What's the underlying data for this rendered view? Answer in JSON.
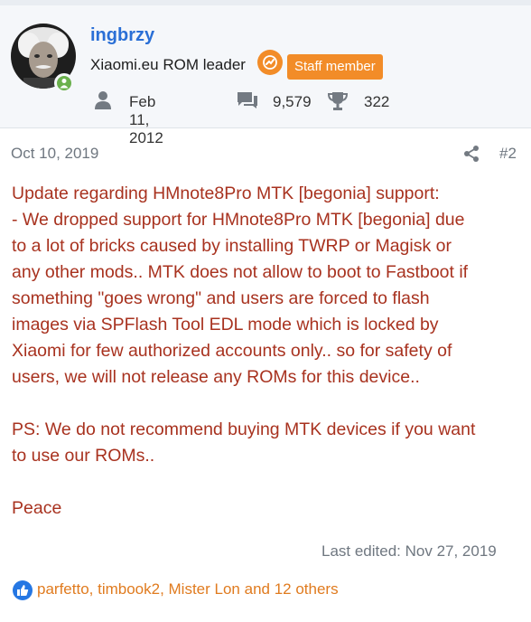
{
  "user": {
    "name": "ingbrzy",
    "role": "Xiaomi.eu ROM leader",
    "badge": "Staff member",
    "joined": "Feb 11, 2012",
    "messages": "9,579",
    "points": "322",
    "colors": {
      "username": "#2a6fd6",
      "badge": "#f28c28",
      "online": "#6ab04c"
    },
    "icons": [
      "user-icon",
      "messages-icon",
      "trophy-icon"
    ]
  },
  "post": {
    "date": "Oct 10, 2019",
    "number": "#2",
    "lines": [
      "Update regarding HMnote8Pro MTK [begonia] support:",
      "- We dropped support for HMnote8Pro MTK [begonia] due",
      "to a lot of bricks caused by installing TWRP or Magisk or",
      "any other mods.. MTK does not allow to boot to Fastboot if",
      "something \"goes wrong\" and users are forced to flash",
      "images via SPFlash Tool EDL mode which is locked by",
      "Xiaomi for few authorized accounts only.. so for safety of",
      "users, we will not release any ROMs for this device.."
    ],
    "ps_lines": [
      "PS: We do not recommend buying MTK devices if you want",
      "to use our ROMs.."
    ],
    "closing": "Peace",
    "text_color": "#a8321f",
    "last_edited": "Last edited: Nov 27, 2019"
  },
  "reactions": {
    "text": "parfetto, timbook2, Mister Lon and 12 others",
    "color": "#e07b1f",
    "icon": "thumbs-up-icon"
  }
}
